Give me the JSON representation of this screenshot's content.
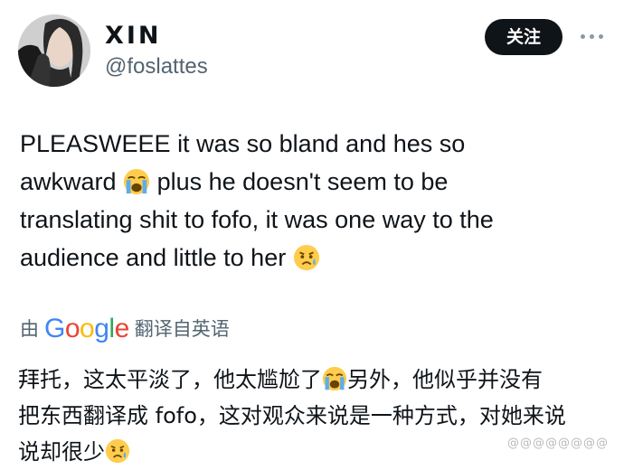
{
  "profile": {
    "display_name": "XIN",
    "handle": "@foslattes"
  },
  "follow_button": {
    "label": "关注"
  },
  "more_button": {
    "icon": "more-horizontal-icon"
  },
  "tweet": {
    "line1": "PLEASWEEE it was so bland and hes so",
    "line2a": "awkward",
    "line2b": "plus he doesn't seem to be",
    "line3": "translating shit to fofo, it was one way to the",
    "line4": "audience and little to her",
    "emoji_1": "loudly-crying-face-emoji",
    "emoji_2": "sad-but-relieved-face-emoji"
  },
  "translation": {
    "prefix": "由",
    "provider": "Google",
    "suffix": "翻译自英语",
    "provider_colors": [
      "#4285F4",
      "#EA4335",
      "#FBBC05",
      "#4285F4",
      "#34A853",
      "#EA4335"
    ],
    "line1a": "拜托，这太平淡了，他太尴尬了",
    "line1b": "另外，他似乎并没有",
    "line2": "把东西翻译成 fofo，这对观众来说是一种方式，对她来说",
    "line3": "说却很少"
  },
  "watermark": {
    "text": "@@@@@@@@"
  },
  "colors": {
    "text_primary": "#0f1419",
    "text_secondary": "#536471",
    "button_bg": "#0f1419",
    "button_text": "#ffffff"
  }
}
